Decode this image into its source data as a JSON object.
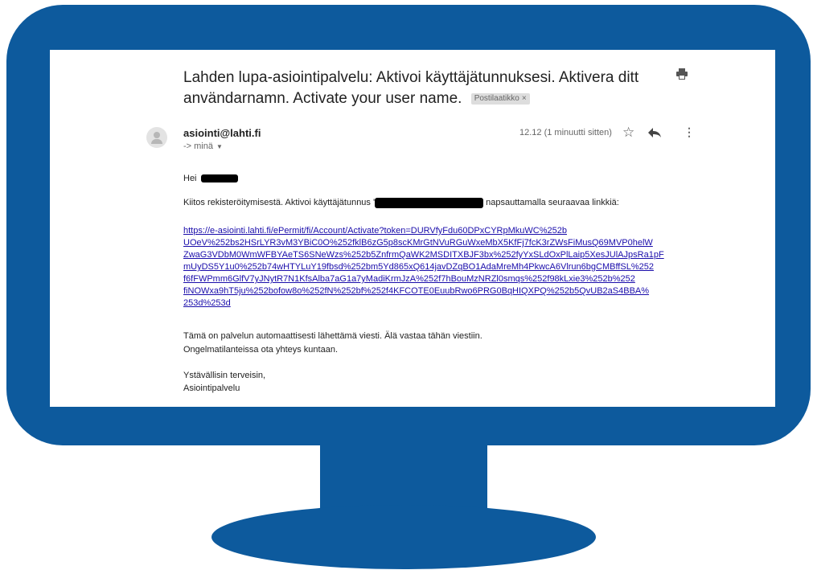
{
  "email": {
    "subject": "Lahden lupa-asiointipalvelu: Aktivoi käyttäjätunnuksesi. Aktivera ditt användarnamn. Activate your user name.",
    "label_badge": "Postilaatikko",
    "label_badge_close": "×",
    "sender": "asiointi@lahti.fi",
    "recipient": "-> minä",
    "time": "12.12 (1 minuutti sitten)",
    "greeting": "Hei",
    "line_thanks_prefix": "Kiitos rekisteröitymisestä. Aktivoi käyttäjätunnus '",
    "line_thanks_suffix": " napsauttamalla seuraavaa linkkiä:",
    "link_lines": [
      "https://e-asiointi.lahti.fi/ePermit/fi/Account/Activate?token=DURVfyFdu60DPxCYRpMkuWC%252b",
      "UOeV%252bs2HSrLYR3vM3YBiC0O%252fklB6zG5p8scKMrGtNVuRGuWxeMbX5KfFj7fcK3rZWsFiMusQ69MVP0helW",
      "ZwaG3VDbM0WmWFBYAeTS6SNeWzs%252b5ZnfrmQaWK2MSDITXBJF3bx%252fyYxSLdOxPlLaip5XesJUlAJpsRa1pF",
      "mUyDS5Y1u0%252b74wHTYLuY19fbsd%252bm5Yd865xQ614javDZqBO1AdaMreMh4PkwcA6Vlrun6bgCMBffSL%252",
      "f6fFWPmm6GlfV7yJNytR7N1KfsAlba7aG1a7yMadiKrmJzA%252f7hBouMzNRZl0smqs%252f98kLxie3%252b%252",
      "fiNOWxa9hT5ju%252bofow8o%252fN%252bf%252f4KFCOTE0EuubRwo6PRG0BqHIQXPQ%252b5QvUB2aS4BBA%",
      "253d%253d"
    ],
    "auto_line1": "Tämä on palvelun automaattisesti lähettämä viesti. Älä vastaa tähän viestiin.",
    "auto_line2": "Ongelmatilanteissa ota yhteys kuntaan.",
    "closing1": "Ystävällisin terveisin,",
    "closing2": "Asiointipalvelu"
  },
  "icons": {
    "print": "printer-icon",
    "star": "star-icon",
    "reply": "reply-icon",
    "more": "more-vertical-icon",
    "avatar": "avatar-placeholder-icon"
  },
  "colors": {
    "monitor": "#0d5a9d",
    "link": "#1a0dab",
    "text": "#222222",
    "muted": "#666666"
  }
}
